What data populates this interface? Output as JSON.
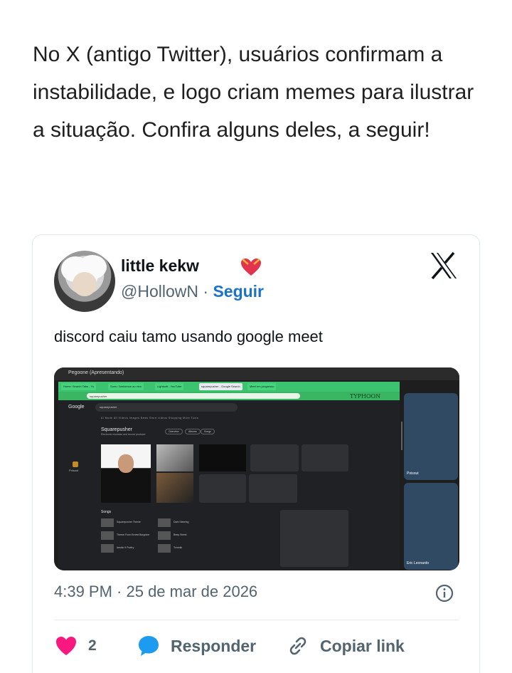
{
  "article": {
    "paragraph": "No X (antigo Twitter), usuários confirmam a instabilidade, e logo criam memes para ilustrar a situação. Confira alguns deles, a seguir!"
  },
  "tweet": {
    "display_name": "little kekw",
    "handle": "@HollowN",
    "separator": " · ",
    "follow_label": "Seguir",
    "text": "discord caiu tamo usando google meet",
    "timestamp": "4:39 PM · 25 de mar de 2026",
    "like_count": "2",
    "reply_label": "Responder",
    "copy_link_label": "Copiar link",
    "colors": {
      "heart": "#f91880",
      "reply": "#1d9bf0",
      "follow": "#1a73c8",
      "muted": "#536471"
    }
  },
  "media": {
    "meet_title": "Pegoone (Apresentando)",
    "tabs": [
      "Home: Search Tabs - Yo",
      "Sons / Ambience ao vivo",
      "Lightsoft - YouTube",
      "squarepusher - Google Search",
      "Meet em progresso"
    ],
    "url": "squarepusher",
    "banner": "TYPHOON",
    "google_logo": "Google",
    "search_query": "squarepusher",
    "google_tabs": "AI Mode   All   Videos   Images   News   Short videos   Shopping   More   Tools",
    "kp_title": "Squarepusher",
    "kp_subtitle": "Electronic musician and record producer",
    "chips": [
      "Overview",
      "Albums",
      "Songs"
    ],
    "songs_title": "Songs",
    "songs": [
      "Squarepusher Theme",
      "Dark Steering",
      "Theme From Ernest Borgnine",
      "Beep Street",
      "Iambic 9 Poetry",
      "Tommib"
    ],
    "poisout_left": "Poisout",
    "tile_labels": [
      "Poisout",
      "Eric Leonardo"
    ]
  }
}
